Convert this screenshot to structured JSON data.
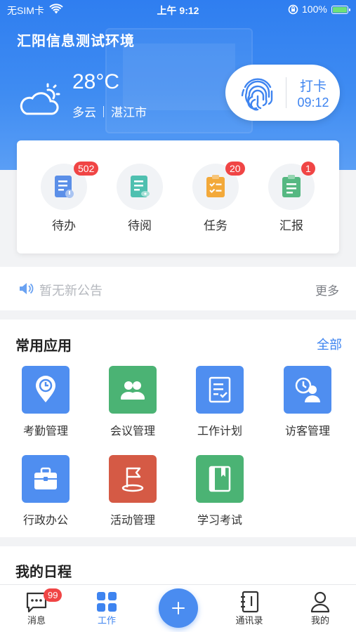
{
  "status_bar": {
    "carrier": "无SIM卡",
    "time": "上午 9:12",
    "battery": "100%"
  },
  "header": {
    "title": "汇阳信息测试环境"
  },
  "weather": {
    "temperature": "28°C",
    "condition": "多云",
    "city": "湛江市",
    "icon": "cloud-sun-icon"
  },
  "checkin": {
    "label": "打卡",
    "time": "09:12",
    "icon": "fingerprint-icon"
  },
  "quick_items": [
    {
      "label": "待办",
      "badge": "502",
      "color": "#5b8fe8",
      "icon": "todo-doc-icon"
    },
    {
      "label": "待阅",
      "badge": "",
      "color": "#4fc0b0",
      "icon": "read-doc-icon"
    },
    {
      "label": "任务",
      "badge": "20",
      "color": "#f3a93a",
      "icon": "task-clipboard-icon"
    },
    {
      "label": "汇报",
      "badge": "1",
      "color": "#56b882",
      "icon": "report-clipboard-icon"
    }
  ],
  "notice": {
    "text": "暂无新公告",
    "more": "更多"
  },
  "apps": {
    "title": "常用应用",
    "all_label": "全部",
    "items": [
      {
        "label": "考勤管理",
        "color": "#4f8ef0",
        "icon": "attendance-pin-icon"
      },
      {
        "label": "会议管理",
        "color": "#4bb374",
        "icon": "meeting-people-icon"
      },
      {
        "label": "工作计划",
        "color": "#4f8ef0",
        "icon": "work-plan-icon"
      },
      {
        "label": "访客管理",
        "color": "#4f8ef0",
        "icon": "visitor-icon"
      },
      {
        "label": "行政办公",
        "color": "#4f8ef0",
        "icon": "briefcase-icon"
      },
      {
        "label": "活动管理",
        "color": "#d55a45",
        "icon": "flag-icon"
      },
      {
        "label": "学习考试",
        "color": "#4bb374",
        "icon": "book-icon"
      }
    ]
  },
  "schedule": {
    "title": "我的日程"
  },
  "tabs": [
    {
      "label": "消息",
      "badge": "99",
      "icon": "message-icon"
    },
    {
      "label": "工作",
      "icon": "grid-icon",
      "active": true
    },
    {
      "label": "",
      "icon": "plus-icon"
    },
    {
      "label": "通讯录",
      "icon": "contacts-book-icon"
    },
    {
      "label": "我的",
      "icon": "person-icon"
    }
  ]
}
